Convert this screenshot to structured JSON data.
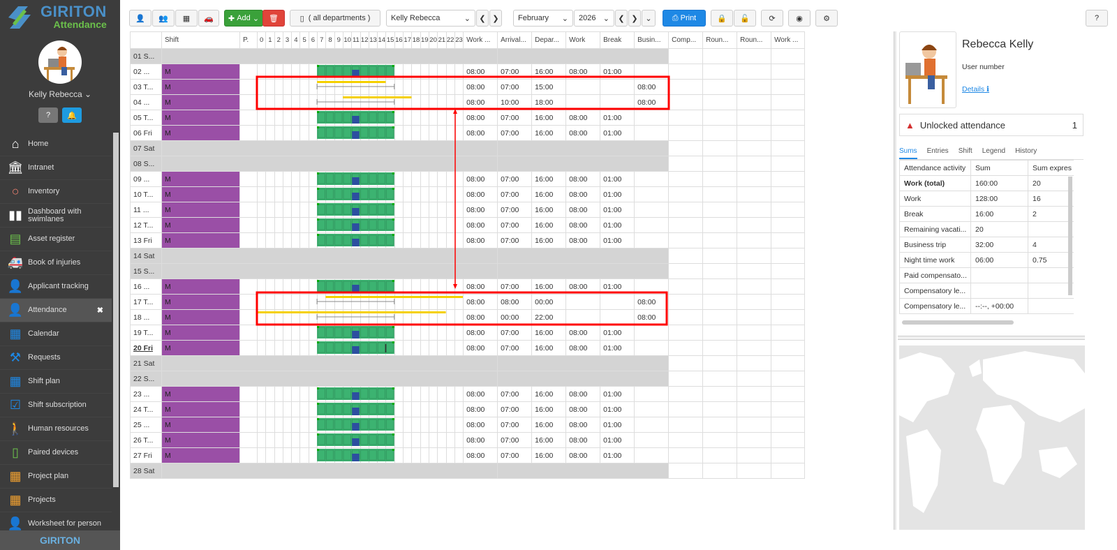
{
  "app": {
    "brand": "GIRITON",
    "subtitle": "Attendance",
    "footer_brand": "GIRITON"
  },
  "user": {
    "name": "Kelly Rebecca"
  },
  "nav": [
    {
      "label": "Home",
      "icon": "home-icon"
    },
    {
      "label": "Intranet",
      "icon": "building-icon"
    },
    {
      "label": "Inventory",
      "icon": "circle-icon"
    },
    {
      "label": "Dashboard with swimlanes",
      "icon": "columns-icon"
    },
    {
      "label": "Asset register",
      "icon": "archive-icon"
    },
    {
      "label": "Book of injuries",
      "icon": "ambulance-icon"
    },
    {
      "label": "Applicant tracking",
      "icon": "user-plus-icon"
    },
    {
      "label": "Attendance",
      "icon": "user-icon",
      "active": true
    },
    {
      "label": "Calendar",
      "icon": "calendar-icon"
    },
    {
      "label": "Requests",
      "icon": "gavel-icon"
    },
    {
      "label": "Shift plan",
      "icon": "calendar-grid-icon"
    },
    {
      "label": "Shift subscription",
      "icon": "calendar-check-icon"
    },
    {
      "label": "Human resources",
      "icon": "person-icon"
    },
    {
      "label": "Paired devices",
      "icon": "phone-icon"
    },
    {
      "label": "Project plan",
      "icon": "calendar-grid-icon"
    },
    {
      "label": "Projects",
      "icon": "calendar-grid-icon"
    },
    {
      "label": "Worksheet for person",
      "icon": "user-icon"
    }
  ],
  "toolbar": {
    "add_label": "Add",
    "departments": "( all departments )",
    "person": "Kelly Rebecca",
    "month": "February",
    "year": "2026",
    "print_label": "Print"
  },
  "grid": {
    "headers": {
      "day": "",
      "shift": "Shift",
      "p": "P.",
      "work": "Work ...",
      "arrival": "Arrival...",
      "departure": "Depar...",
      "work2": "Work",
      "break": "Break",
      "business": "Busin...",
      "comp": "Comp...",
      "round1": "Roun...",
      "round2": "Roun...",
      "work3": "Work ..."
    },
    "hours": [
      "0",
      "1",
      "2",
      "3",
      "4",
      "5",
      "6",
      "7",
      "8",
      "9",
      "10",
      "11",
      "12",
      "13",
      "14",
      "15",
      "16",
      "17",
      "18",
      "19",
      "20",
      "21",
      "22",
      "23"
    ],
    "rows": [
      {
        "day": "01 S...",
        "weekend": true
      },
      {
        "day": "02 ...",
        "shift": "M",
        "work": "08:00",
        "arr": "07:00",
        "dep": "16:00",
        "w2": "08:00",
        "brk": "01:00",
        "bus": "",
        "bar": "work"
      },
      {
        "day": "03 T...",
        "shift": "M",
        "work": "08:00",
        "arr": "07:00",
        "dep": "15:00",
        "w2": "",
        "brk": "",
        "bus": "08:00",
        "bar": "trip",
        "ys": 7,
        "ye": 15
      },
      {
        "day": "04 ...",
        "shift": "M",
        "work": "08:00",
        "arr": "10:00",
        "dep": "18:00",
        "w2": "",
        "brk": "",
        "bus": "08:00",
        "bar": "trip",
        "ys": 10,
        "ye": 18
      },
      {
        "day": "05 T...",
        "shift": "M",
        "work": "08:00",
        "arr": "07:00",
        "dep": "16:00",
        "w2": "08:00",
        "brk": "01:00",
        "bus": "",
        "bar": "work"
      },
      {
        "day": "06 Fri",
        "shift": "M",
        "work": "08:00",
        "arr": "07:00",
        "dep": "16:00",
        "w2": "08:00",
        "brk": "01:00",
        "bus": "",
        "bar": "work"
      },
      {
        "day": "07 Sat",
        "weekend": true
      },
      {
        "day": "08 S...",
        "weekend": true
      },
      {
        "day": "09 ...",
        "shift": "M",
        "work": "08:00",
        "arr": "07:00",
        "dep": "16:00",
        "w2": "08:00",
        "brk": "01:00",
        "bus": "",
        "bar": "work"
      },
      {
        "day": "10 T...",
        "shift": "M",
        "work": "08:00",
        "arr": "07:00",
        "dep": "16:00",
        "w2": "08:00",
        "brk": "01:00",
        "bus": "",
        "bar": "work"
      },
      {
        "day": "11 ...",
        "shift": "M",
        "work": "08:00",
        "arr": "07:00",
        "dep": "16:00",
        "w2": "08:00",
        "brk": "01:00",
        "bus": "",
        "bar": "work"
      },
      {
        "day": "12 T...",
        "shift": "M",
        "work": "08:00",
        "arr": "07:00",
        "dep": "16:00",
        "w2": "08:00",
        "brk": "01:00",
        "bus": "",
        "bar": "work"
      },
      {
        "day": "13 Fri",
        "shift": "M",
        "work": "08:00",
        "arr": "07:00",
        "dep": "16:00",
        "w2": "08:00",
        "brk": "01:00",
        "bus": "",
        "bar": "work"
      },
      {
        "day": "14 Sat",
        "weekend": true
      },
      {
        "day": "15 S...",
        "weekend": true
      },
      {
        "day": "16 ...",
        "shift": "M",
        "work": "08:00",
        "arr": "07:00",
        "dep": "16:00",
        "w2": "08:00",
        "brk": "01:00",
        "bus": "",
        "bar": "work"
      },
      {
        "day": "17 T...",
        "shift": "M",
        "work": "08:00",
        "arr": "08:00",
        "dep": "00:00",
        "w2": "",
        "brk": "",
        "bus": "08:00",
        "bar": "trip",
        "ys": 8,
        "ye": 24
      },
      {
        "day": "18 ...",
        "shift": "M",
        "work": "08:00",
        "arr": "00:00",
        "dep": "22:00",
        "w2": "",
        "brk": "",
        "bus": "08:00",
        "bar": "trip",
        "ys": 0,
        "ye": 22
      },
      {
        "day": "19 T...",
        "shift": "M",
        "work": "08:00",
        "arr": "07:00",
        "dep": "16:00",
        "w2": "08:00",
        "brk": "01:00",
        "bus": "",
        "bar": "work"
      },
      {
        "day": "20 Fri",
        "shift": "M",
        "work": "08:00",
        "arr": "07:00",
        "dep": "16:00",
        "w2": "08:00",
        "brk": "01:00",
        "bus": "",
        "bar": "work",
        "today": true
      },
      {
        "day": "21 Sat",
        "weekend": true
      },
      {
        "day": "22 S...",
        "weekend": true
      },
      {
        "day": "23 ...",
        "shift": "M",
        "work": "08:00",
        "arr": "07:00",
        "dep": "16:00",
        "w2": "08:00",
        "brk": "01:00",
        "bus": "",
        "bar": "work"
      },
      {
        "day": "24 T...",
        "shift": "M",
        "work": "08:00",
        "arr": "07:00",
        "dep": "16:00",
        "w2": "08:00",
        "brk": "01:00",
        "bus": "",
        "bar": "work"
      },
      {
        "day": "25 ...",
        "shift": "M",
        "work": "08:00",
        "arr": "07:00",
        "dep": "16:00",
        "w2": "08:00",
        "brk": "01:00",
        "bus": "",
        "bar": "work"
      },
      {
        "day": "26 T...",
        "shift": "M",
        "work": "08:00",
        "arr": "07:00",
        "dep": "16:00",
        "w2": "08:00",
        "brk": "01:00",
        "bus": "",
        "bar": "work"
      },
      {
        "day": "27 Fri",
        "shift": "M",
        "work": "08:00",
        "arr": "07:00",
        "dep": "16:00",
        "w2": "08:00",
        "brk": "01:00",
        "bus": "",
        "bar": "work"
      },
      {
        "day": "28 Sat",
        "weekend": true
      }
    ]
  },
  "profile": {
    "name": "Rebecca Kelly",
    "user_number": "User number",
    "details": "Details"
  },
  "unlocked": {
    "label": "Unlocked attendance",
    "count": "1"
  },
  "tabs": [
    "Sums",
    "Entries",
    "Shift",
    "Legend",
    "History"
  ],
  "sums": {
    "headers": [
      "Attendance activity",
      "Sum",
      "Sum expres"
    ],
    "rows": [
      [
        "Work (total)",
        "160:00",
        "20"
      ],
      [
        "Work",
        "128:00",
        "16"
      ],
      [
        "Break",
        "16:00",
        "2"
      ],
      [
        "Remaining vacati...",
        "20",
        ""
      ],
      [
        "Business trip",
        "32:00",
        "4"
      ],
      [
        "Night time work",
        "06:00",
        "0.75"
      ],
      [
        "Paid compensato...",
        "",
        ""
      ],
      [
        "Compensatory le...",
        "",
        ""
      ],
      [
        "Compensatory le...",
        "--:--, +00:00",
        ""
      ]
    ]
  },
  "colors": {
    "shift": "#9a4fa6",
    "work_bar": "#3cb371",
    "trip_bar": "#f5d000",
    "highlight": "#ff0000",
    "accent": "#1e88e5"
  }
}
